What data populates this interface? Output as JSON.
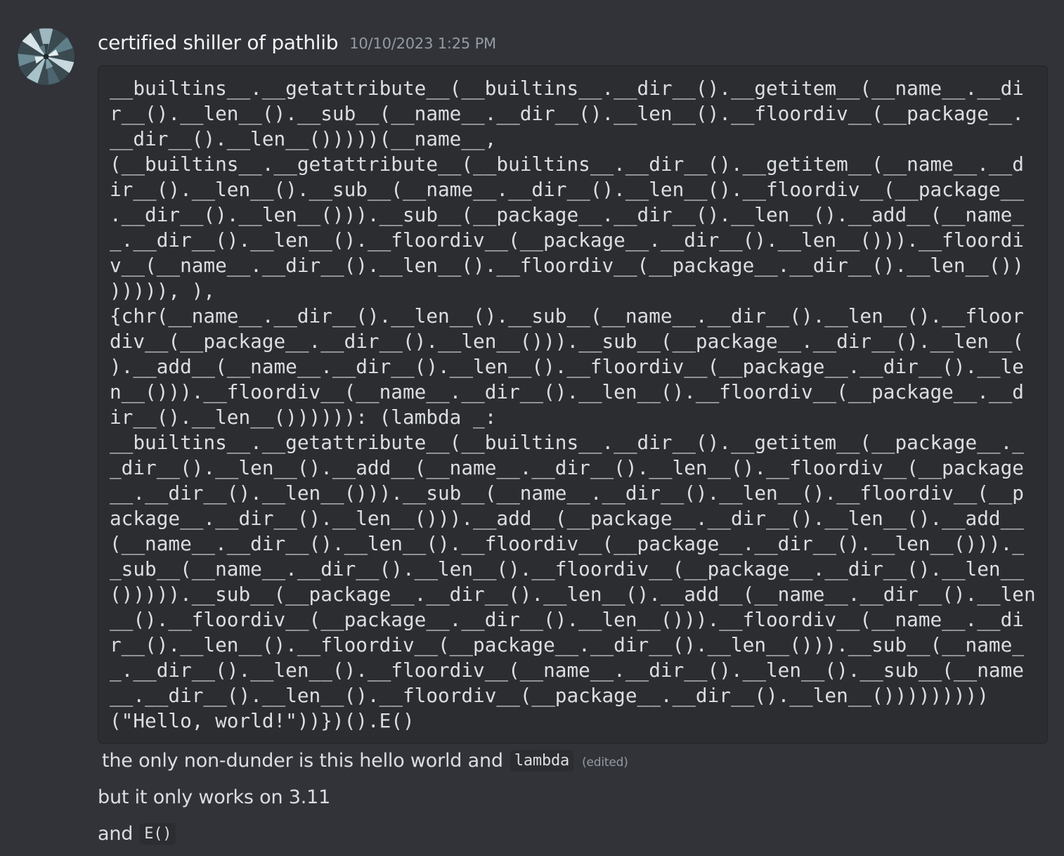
{
  "message": {
    "username": "certified shiller of pathlib",
    "timestamp": "10/10/2023 1:25 PM",
    "avatar_icon": "kaleidoscope-avatar-icon",
    "code_lines": [
      "__builtins__.__getattribute__(__builtins__.__dir__().__getitem__(__name__.__di",
      "r__().__len__().__sub__(__name__.__dir__().__len__().__floordiv__(__package__.",
      "__dir__().__len__()))))(__name__,",
      "(__builtins__.__getattribute__(__builtins__.__dir__().__getitem__(__name__.__d",
      "ir__().__len__().__sub__(__name__.__dir__().__len__().__floordiv__(__package__",
      ".__dir__().__len__())).__sub__(__package__.__dir__().__len__().__add__(__name_",
      "_.__dir__().__len__().__floordiv__(__package__.__dir__().__len__())).__floordi",
      "v__(__name__.__dir__().__len__().__floordiv__(__package__.__dir__().__len__())",
      "))))), ),",
      "{chr(__name__.__dir__().__len__().__sub__(__name__.__dir__().__len__().__floor",
      "div__(__package__.__dir__().__len__())).__sub__(__package__.__dir__().__len__(",
      ").__add__(__name__.__dir__().__len__().__floordiv__(__package__.__dir__().__le",
      "n__())).__floordiv__(__name__.__dir__().__len__().__floordiv__(__package__.__d",
      "ir__().__len__()))))): (lambda _:",
      "__builtins__.__getattribute__(__builtins__.__dir__().__getitem__(__package__._",
      "_dir__().__len__().__add__(__name__.__dir__().__len__().__floordiv__(__package",
      "__.__dir__().__len__())).__sub__(__name__.__dir__().__len__().__floordiv__(__p",
      "ackage__.__dir__().__len__())).__add__(__package__.__dir__().__len__().__add__",
      "(__name__.__dir__().__len__().__floordiv__(__package__.__dir__().__len__()))._",
      "_sub__(__name__.__dir__().__len__().__floordiv__(__package__.__dir__().__len__",
      "())))).__sub__(__package__.__dir__().__len__().__add__(__name__.__dir__().__len",
      "__().__floordiv__(__package__.__dir__().__len__())).__floordiv__(__name__.__di",
      "r__().__len__().__floordiv__(__package__.__dir__().__len__())).__sub__(__name_",
      "_.__dir__().__len__().__floordiv__(__name__.__dir__().__len__().__sub__(__name",
      "__.__dir__().__len__().__floordiv__(__package__.__dir__().__len__()))))))))",
      "(\"Hello, world!\"))})().E()"
    ],
    "followups": [
      {
        "text": "the only non-dunder is this hello world and",
        "code": "lambda",
        "edited": "(edited)"
      },
      {
        "text": "but it only works on 3.11"
      },
      {
        "text": "and",
        "code": "E()"
      }
    ]
  }
}
